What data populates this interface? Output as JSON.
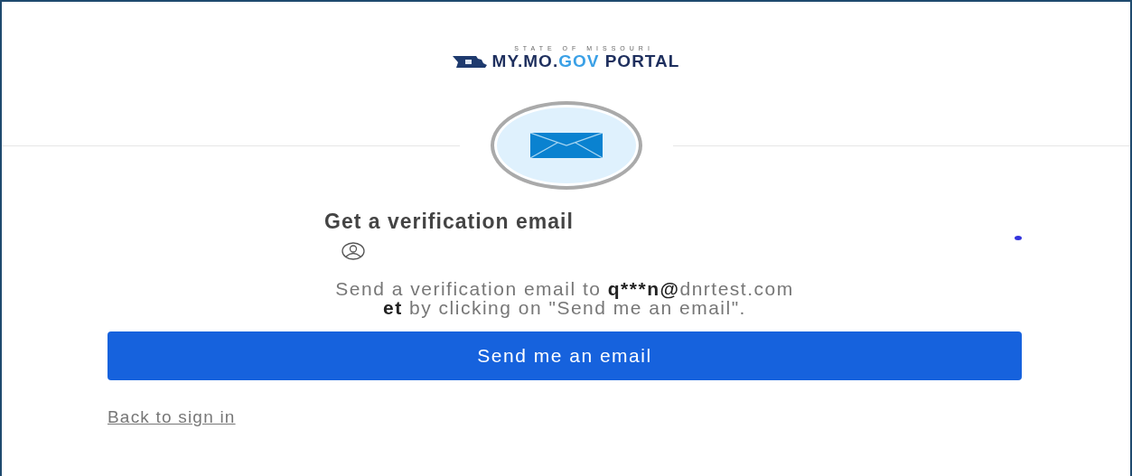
{
  "logo": {
    "tagline": "STATE OF MISSOURI",
    "name_first": "MY.MO.",
    "name_mid": "GOV",
    "name_last": " PORTAL"
  },
  "heading": "Get a verification email",
  "message": {
    "intro": "Send a verification email to ",
    "email_user": "q***n@",
    "email_domain": "dnrtest.com",
    "email_tail": "et",
    "rest": " by clicking on \"Send me an email\"."
  },
  "primary_button": "Send me an email",
  "back_link": "Back to sign in"
}
